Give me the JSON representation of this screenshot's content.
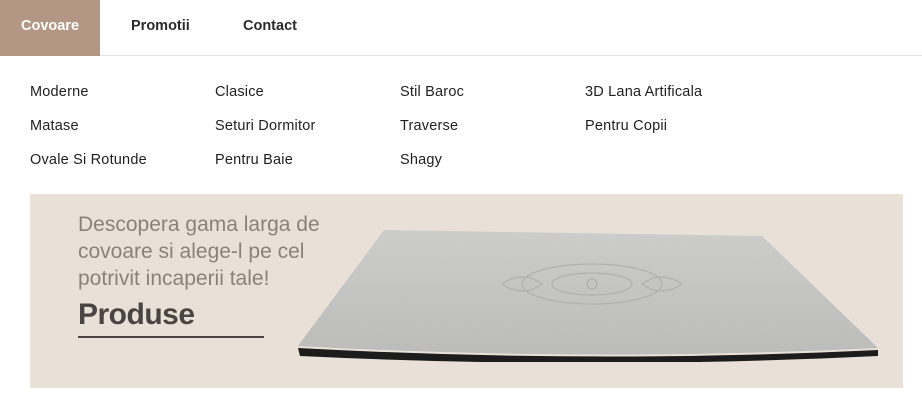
{
  "nav": {
    "items": [
      {
        "label": "Covoare",
        "active": true
      },
      {
        "label": "Promotii",
        "active": false
      },
      {
        "label": "Contact",
        "active": false
      }
    ]
  },
  "categories": {
    "col1": [
      "Moderne",
      "Matase",
      "Ovale Si Rotunde"
    ],
    "col2": [
      "Clasice",
      "Seturi Dormitor",
      "Pentru Baie"
    ],
    "col3": [
      "Stil Baroc",
      "Traverse",
      "Shagy"
    ],
    "col4": [
      "3D Lana Artificala",
      "Pentru Copii"
    ]
  },
  "banner": {
    "line1": "Descopera gama larga de",
    "line2": "covoare si alege-l pe cel",
    "line3": "potrivit incaperii tale!",
    "cta": "Produse"
  },
  "colors": {
    "accent": "#b39684",
    "banner_bg": "#e9e1d8",
    "banner_text": "#8c8179",
    "cta_text": "#4a4542"
  }
}
